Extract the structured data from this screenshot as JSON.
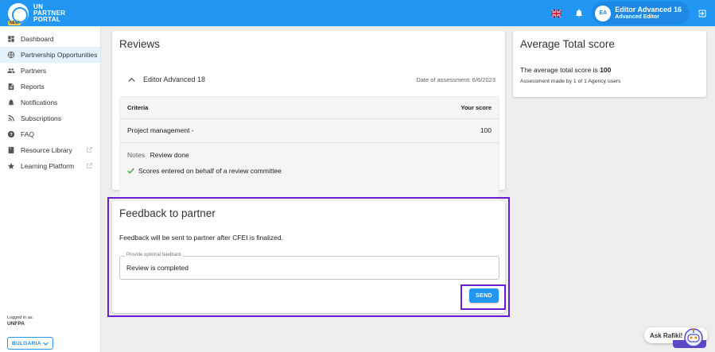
{
  "header": {
    "logo_text": [
      "UN",
      "PARTNER",
      "PORTAL"
    ],
    "logo_badge": "NEW",
    "user_initials": "EA",
    "user_name": "Editor Advanced 16",
    "user_role": "Advanced Editor",
    "brand_color": "#2196f3"
  },
  "sidebar": {
    "items": [
      {
        "label": "Dashboard",
        "icon": "dashboard-icon"
      },
      {
        "label": "Partnership Opportunities",
        "icon": "globe-icon",
        "active": true
      },
      {
        "label": "Partners",
        "icon": "people-icon"
      },
      {
        "label": "Reports",
        "icon": "reports-icon"
      },
      {
        "label": "Notifications",
        "icon": "bell-icon"
      },
      {
        "label": "Subscriptions",
        "icon": "rss-icon"
      },
      {
        "label": "FAQ",
        "icon": "help-icon"
      },
      {
        "label": "Resource Library",
        "icon": "book-icon",
        "external": true
      },
      {
        "label": "Learning Platform",
        "icon": "star-icon",
        "external": true
      }
    ],
    "logged_in_label": "Logged in as:",
    "logged_in_org": "UNFPA",
    "country": "BULGARIA"
  },
  "reviews": {
    "title": "Reviews",
    "reviewer": "Editor Advanced 18",
    "date_label": "Date of assessment: 6/6/2023",
    "col_criteria": "Criteria",
    "col_score": "Your score",
    "rows": [
      {
        "criteria": "Project management -",
        "score": "100"
      }
    ],
    "notes_label": "Notes",
    "notes_value": "Review done",
    "committee_text": "Scores entered on behalf of a review committee"
  },
  "average": {
    "title": "Average Total score",
    "line_prefix": "The average total score is",
    "score": "100",
    "made_by": "Assessment made by 1 of 1 Agency users"
  },
  "feedback": {
    "title": "Feedback to partner",
    "info": "Feedback will be sent to partner after CFEI is finalized.",
    "field_label": "Provide optional feedback",
    "field_value": "Review is completed",
    "send_label": "SEND",
    "highlight_color": "#6a1bd8"
  },
  "rafiki": {
    "label": "Ask Rafiki!"
  }
}
